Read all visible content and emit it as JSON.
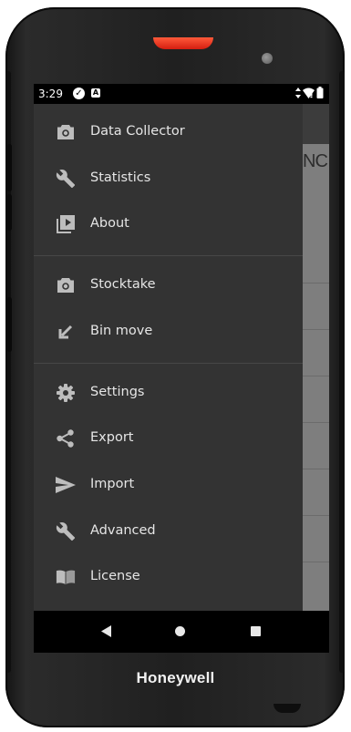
{
  "device": {
    "brand": "Honeywell"
  },
  "status_bar": {
    "time": "3:29"
  },
  "app_behind": {
    "heading_text": "NC"
  },
  "drawer": {
    "items": [
      {
        "label": "Data Collector",
        "icon": "camera-icon"
      },
      {
        "label": "Statistics",
        "icon": "wrench-icon"
      },
      {
        "label": "About",
        "icon": "video-library-icon"
      },
      {
        "label": "Stocktake",
        "icon": "camera-icon"
      },
      {
        "label": "Bin move",
        "icon": "arrow-down-left-icon"
      },
      {
        "label": "Settings",
        "icon": "gear-icon"
      },
      {
        "label": "Export",
        "icon": "share-icon"
      },
      {
        "label": "Import",
        "icon": "send-icon"
      },
      {
        "label": "Advanced",
        "icon": "wrench-icon"
      },
      {
        "label": "License",
        "icon": "book-icon"
      }
    ]
  },
  "nav_bar": {
    "buttons": [
      "back",
      "home",
      "recents"
    ]
  }
}
